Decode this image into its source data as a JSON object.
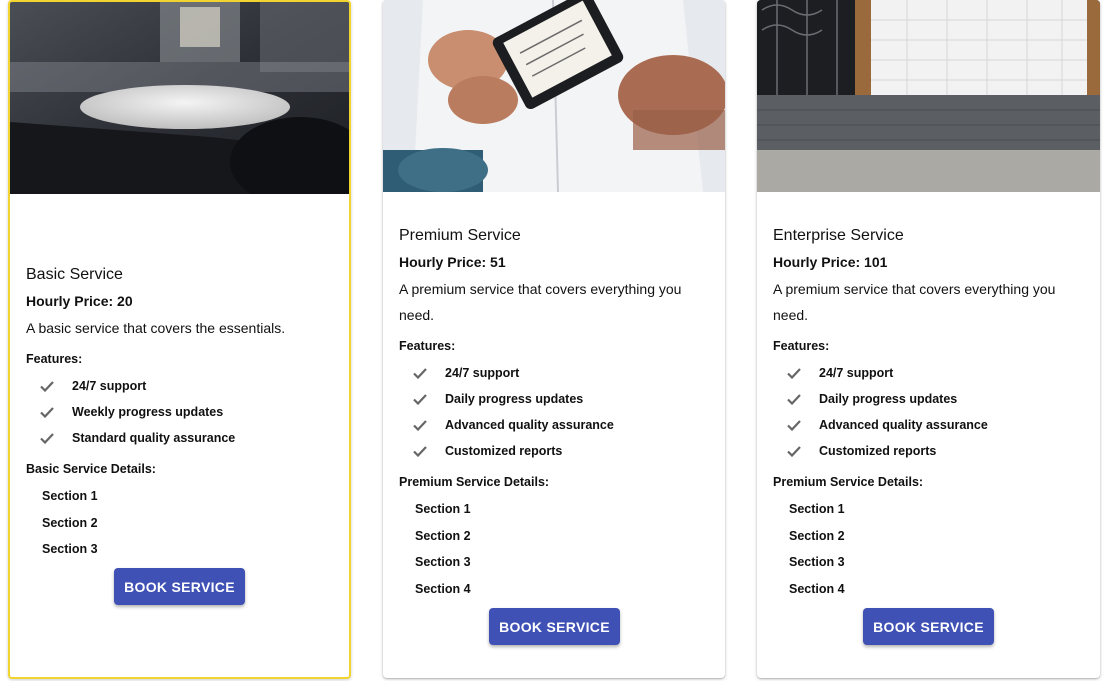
{
  "cards": [
    {
      "title": "Basic Service",
      "price": "Hourly Price: 20",
      "description": "A basic service that covers the essentials.",
      "features_label": "Features:",
      "features": [
        "24/7 support",
        "Weekly progress updates",
        "Standard quality assurance"
      ],
      "details_label": "Basic Service Details:",
      "sections": [
        "Section 1",
        "Section 2",
        "Section 3"
      ],
      "button": "BOOK SERVICE",
      "selected": true
    },
    {
      "title": "Premium Service",
      "price": "Hourly Price: 51",
      "description": "A premium service that covers everything you need.",
      "features_label": "Features:",
      "features": [
        "24/7 support",
        "Daily progress updates",
        "Advanced quality assurance",
        "Customized reports"
      ],
      "details_label": "Premium Service Details:",
      "sections": [
        "Section 1",
        "Section 2",
        "Section 3",
        "Section 4"
      ],
      "button": "BOOK SERVICE",
      "selected": false
    },
    {
      "title": "Enterprise Service",
      "price": "Hourly Price: 101",
      "description": "A premium service that covers everything you need.",
      "features_label": "Features:",
      "features": [
        "24/7 support",
        "Daily progress updates",
        "Advanced quality assurance",
        "Customized reports"
      ],
      "details_label": "Premium Service Details:",
      "sections": [
        "Section 1",
        "Section 2",
        "Section 3",
        "Section 4"
      ],
      "button": "BOOK SERVICE",
      "selected": false
    }
  ],
  "theme": {
    "button_color": "#3f51b5",
    "selected_border": "#f2d431",
    "check_color": "#666666"
  },
  "icons": {
    "feature": "check-icon"
  }
}
